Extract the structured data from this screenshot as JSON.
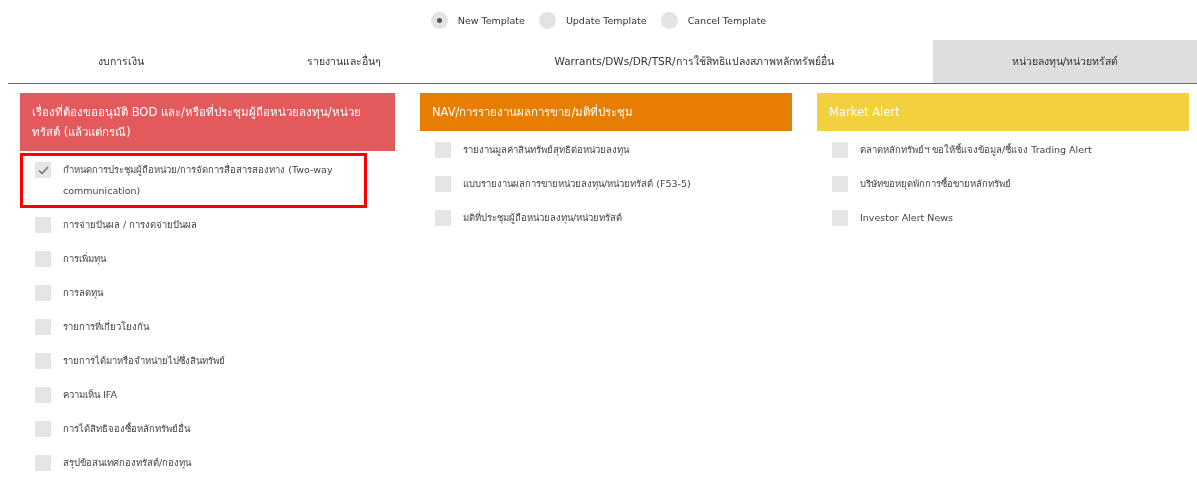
{
  "template_options": [
    {
      "label": "New Template",
      "selected": true
    },
    {
      "label": "Update Template",
      "selected": false
    },
    {
      "label": "Cancel Template",
      "selected": false
    }
  ],
  "tabs": [
    {
      "label": "งบการเงิน",
      "selected": false
    },
    {
      "label": "รายงานและอื่นๆ",
      "selected": false
    },
    {
      "label": "Warrants/DWs/DR/TSR/การใช้สิทธิแปลงสภาพหลักทรัพย์อื่น",
      "selected": false
    },
    {
      "label": "หน่วยลงทุน/หน่วยทรัสต์",
      "selected": true
    }
  ],
  "panels": [
    {
      "title": "เรื่องที่ต้องขออนุมัติ BOD และ/หรือที่ประชุมผู้ถือหน่วยลงทุน/หน่วยทรัสต์ (แล้วแต่กรณี)",
      "color": "#e35a5c",
      "items": [
        {
          "label": "กำหนดการประชุมผู้ถือหน่วย/การจัดการสื่อสารสองทาง (Two-way communication)",
          "checked": true,
          "highlighted": true
        },
        {
          "label": "การจ่ายปันผล / การงดจ่ายปันผล",
          "checked": false,
          "highlighted": false
        },
        {
          "label": "การเพิ่มทุน",
          "checked": false,
          "highlighted": false
        },
        {
          "label": "การลดทุน",
          "checked": false,
          "highlighted": false
        },
        {
          "label": "รายการที่เกี่ยวโยงกัน",
          "checked": false,
          "highlighted": false
        },
        {
          "label": "รายการได้มาหรือจำหน่ายไปซึ่งสินทรัพย์",
          "checked": false,
          "highlighted": false
        },
        {
          "label": "ความเห็น IFA",
          "checked": false,
          "highlighted": false
        },
        {
          "label": "การได้สิทธิจองซื้อหลักทรัพย์อื่น",
          "checked": false,
          "highlighted": false
        },
        {
          "label": "สรุปข้อสนเทศกองทรัสต์/กองทุน",
          "checked": false,
          "highlighted": false
        }
      ]
    },
    {
      "title": "NAV/การรายงานผลการขาย/มติที่ประชุม",
      "color": "#e87d04",
      "items": [
        {
          "label": "รายงานมูลค่าสินทรัพย์สุทธิต่อหน่วยลงทุน",
          "checked": false,
          "highlighted": false
        },
        {
          "label": "แบบรายงานผลการขายหน่วยลงทุน/หน่วยทรัสต์ (F53-5)",
          "checked": false,
          "highlighted": false
        },
        {
          "label": "มติที่ประชุมผู้ถือหน่วยลงทุน/หน่วยทรัสต์",
          "checked": false,
          "highlighted": false
        }
      ]
    },
    {
      "title": "Market Alert",
      "color": "#f3d03e",
      "items": [
        {
          "label": "ตลาดหลักทรัพย์ฯ ขอให้ชี้แจงข้อมูล/ชี้แจง Trading Alert",
          "checked": false,
          "highlighted": false
        },
        {
          "label": "บริษัทขอหยุดพักการซื้อขายหลักทรัพย์",
          "checked": false,
          "highlighted": false
        },
        {
          "label": "Investor Alert News",
          "checked": false,
          "highlighted": false
        }
      ]
    }
  ]
}
